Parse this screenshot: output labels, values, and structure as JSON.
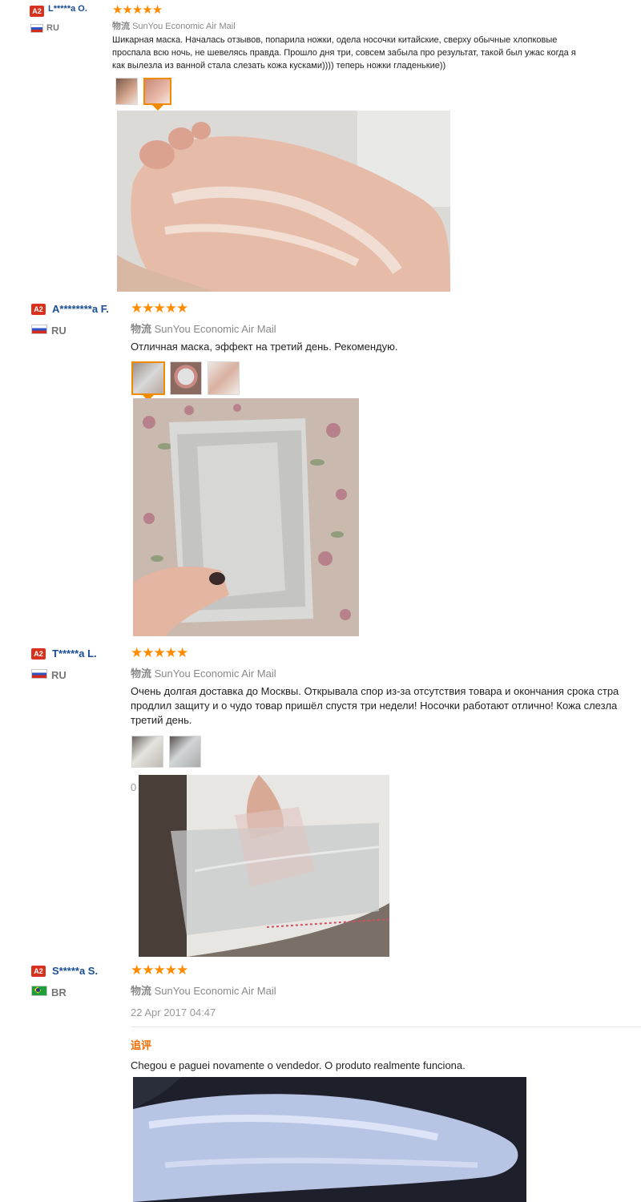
{
  "reviews": [
    {
      "badge": "A2",
      "name": "L*****a O.",
      "country": "RU",
      "stars": "★★★★★",
      "logistics_label": "物流",
      "logistics_value": "SunYou Economic Air Mail",
      "text_lines": [
        "Шикарная маска. Началась отзывов, попарила ножки, одела носочки китайские, сверху обычные хлопковые",
        "проспала всю ночь, не шевелясь правда. Прошло дня три, совсем забыла про результат, такой был ужас когда я",
        "как вылезла из ванной стала слезать кожа кусками)))) теперь ножки гладенькие))"
      ]
    },
    {
      "badge": "A2",
      "name": "A********a F.",
      "country": "RU",
      "stars": "★★★★★",
      "logistics_label": "物流",
      "logistics_value": "SunYou Economic Air Mail",
      "text_lines": [
        "Отличная маска, эффект на третий день. Рекомендую."
      ]
    },
    {
      "badge": "A2",
      "name": "T*****a L.",
      "country": "RU",
      "stars": "★★★★★",
      "logistics_label": "物流",
      "logistics_value": "SunYou Economic Air Mail",
      "text_lines": [
        "Очень долгая доставка до Москвы. Открывала спор из-за отсутствия товара и окончания срока стра",
        "продлил защиту и о чудо товар пришёл спустя три недели! Носочки работают отлично! Кожа слезла",
        "третий день."
      ],
      "cut_date": "0"
    },
    {
      "badge": "A2",
      "name": "S*****a S.",
      "country": "BR",
      "stars": "★★★★★",
      "logistics_label": "物流",
      "logistics_value": "SunYou Economic Air Mail",
      "date": "22 Apr 2017 04:47",
      "additional_label": "追评",
      "text_lines": [
        "Chegou e paguei novamente o vendedor. O produto realmente funciona."
      ]
    }
  ],
  "colors": {
    "accent": "#f08a00",
    "star": "#ff8c00",
    "name": "#1a4d8f",
    "badge": "#d8321f"
  }
}
